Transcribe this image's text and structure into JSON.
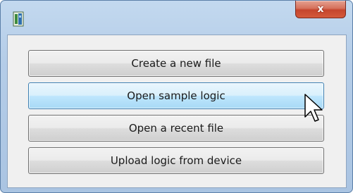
{
  "window": {
    "close_label": "x",
    "icons": {
      "app": "app-icon",
      "close": "close-icon",
      "cursor": "mouse-pointer-icon"
    },
    "colors": {
      "frame": "#b5cde8",
      "close_button": "#c5452d",
      "client": "#f0f0f0"
    }
  },
  "menu": {
    "buttons": [
      {
        "label": "Create a new file"
      },
      {
        "label": "Open sample logic"
      },
      {
        "label": "Open a recent file"
      },
      {
        "label": "Upload logic from device"
      }
    ]
  }
}
